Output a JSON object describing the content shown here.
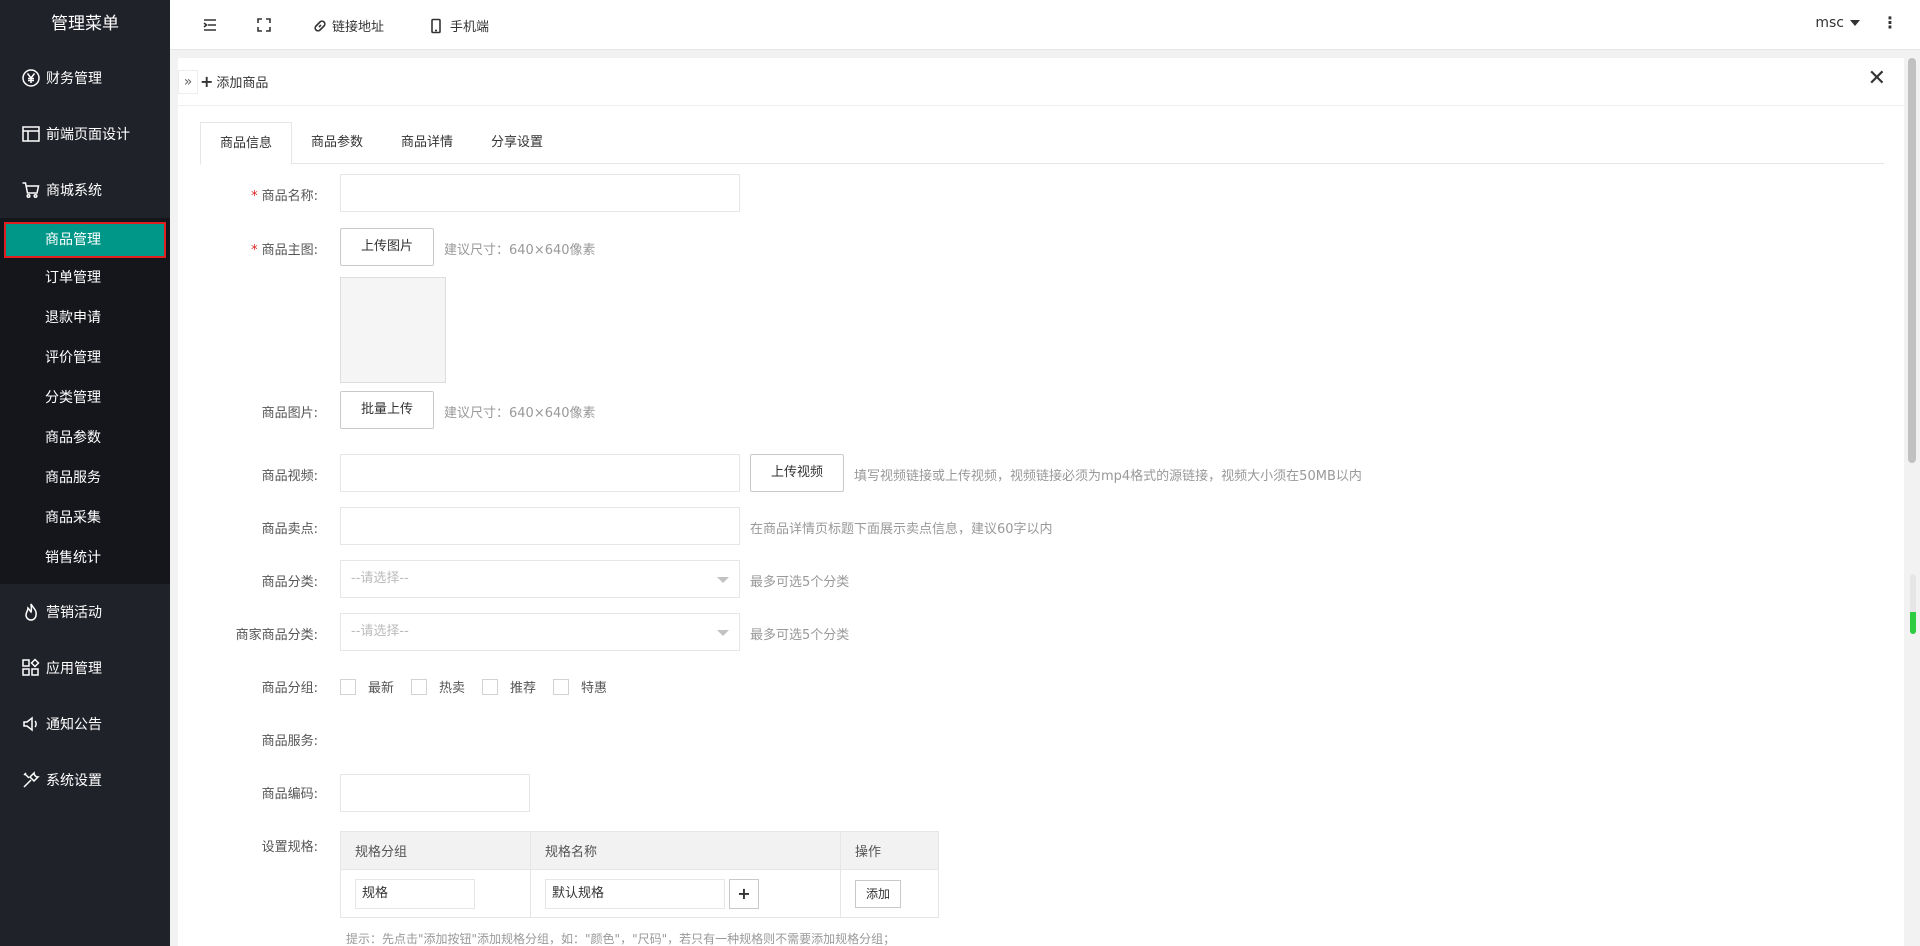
{
  "sidebar": {
    "brand": "管理菜单",
    "items": [
      {
        "label": "财务管理",
        "icon": "yen-icon"
      },
      {
        "label": "前端页面设计",
        "icon": "layout-icon"
      },
      {
        "label": "商城系统",
        "icon": "cart-icon"
      }
    ],
    "submenu": [
      {
        "label": "商品管理",
        "active": true
      },
      {
        "label": "订单管理"
      },
      {
        "label": "退款申请"
      },
      {
        "label": "评价管理"
      },
      {
        "label": "分类管理"
      },
      {
        "label": "商品参数"
      },
      {
        "label": "商品服务"
      },
      {
        "label": "商品采集"
      },
      {
        "label": "销售统计"
      }
    ],
    "items_after": [
      {
        "label": "营销活动",
        "icon": "fire-icon"
      },
      {
        "label": "应用管理",
        "icon": "apps-icon"
      },
      {
        "label": "通知公告",
        "icon": "speaker-icon"
      },
      {
        "label": "系统设置",
        "icon": "tools-icon"
      }
    ],
    "accent": "#009688",
    "bg": "#20222a"
  },
  "topbar": {
    "link_label": "链接地址",
    "mobile_label": "手机端",
    "user": "msc"
  },
  "panel": {
    "title": "添加商品",
    "tabs": [
      "商品信息",
      "商品参数",
      "商品详情",
      "分享设置"
    ]
  },
  "form": {
    "name_label": "商品名称:",
    "main_image_label": "商品主图:",
    "upload_image_btn": "上传图片",
    "size_hint": "建议尺寸：640×640像素",
    "images_label": "商品图片:",
    "batch_upload_btn": "批量上传",
    "video_label": "商品视频:",
    "upload_video_btn": "上传视频",
    "video_hint": "填写视频链接或上传视频，视频链接必须为mp4格式的源链接，视频大小须在50MB以内",
    "selling_label": "商品卖点:",
    "selling_hint": "在商品详情页标题下面展示卖点信息，建议60字以内",
    "category_label": "商品分类:",
    "select_placeholder": "--请选择--",
    "category_hint": "最多可选5个分类",
    "merchant_category_label": "商家商品分类:",
    "group_label": "商品分组:",
    "groups": [
      "最新",
      "热卖",
      "推荐",
      "特惠"
    ],
    "service_label": "商品服务:",
    "code_label": "商品编码:",
    "spec_label": "设置规格:",
    "spec_headers": [
      "规格分组",
      "规格名称",
      "操作"
    ],
    "spec_group_value": "规格",
    "spec_name_value": "默认规格",
    "spec_add_btn": "添加",
    "spec_tip": "提示：先点击\"添加按钮\"添加规格分组，如：\"颜色\"，\"尺码\"，若只有一种规格则不需要添加规格分组；"
  }
}
